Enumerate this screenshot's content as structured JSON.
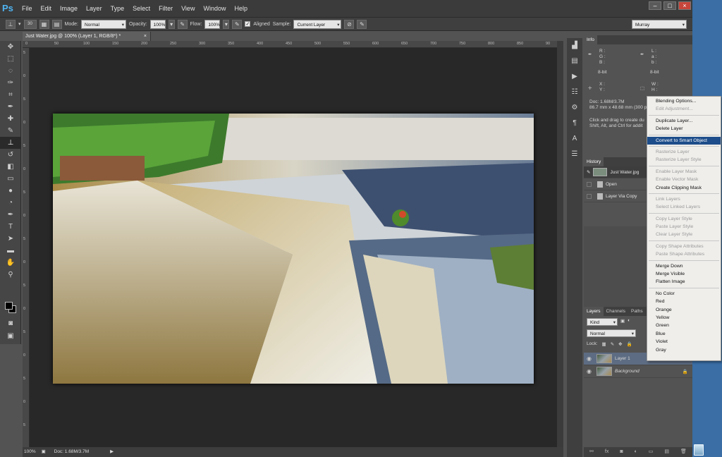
{
  "menubar": {
    "logo": "Ps",
    "items": [
      "File",
      "Edit",
      "Image",
      "Layer",
      "Type",
      "Select",
      "Filter",
      "View",
      "Window",
      "Help"
    ]
  },
  "options": {
    "brush_size": "30",
    "mode_label": "Mode:",
    "mode": "Normal",
    "opacity_label": "Opacity:",
    "opacity": "100%",
    "flow_label": "Flow:",
    "flow": "100%",
    "aligned_label": "Aligned",
    "sample_label": "Sample:",
    "sample": "Current Layer",
    "workspace": "Murray"
  },
  "document": {
    "tab_title": "Just Water.jpg @ 100% (Layer 1, RGB/8*) *",
    "zoom": "100%",
    "doc_size": "Doc: 1.68M/3.7M"
  },
  "ruler": {
    "h_ticks": [
      "0",
      "50",
      "100",
      "150",
      "200",
      "250",
      "300",
      "350",
      "400",
      "450",
      "500",
      "550",
      "600",
      "650",
      "700",
      "750",
      "800",
      "850",
      "90"
    ],
    "v_ticks": [
      "5",
      "0",
      "5",
      "0",
      "5",
      "0",
      "5",
      "0",
      "5",
      "0",
      "5",
      "0",
      "5",
      "0",
      "5",
      "0",
      "5"
    ]
  },
  "info_panel": {
    "tab": "Info",
    "rgb": "R :\nG :\nB :",
    "lab": "L :\na :\nb :",
    "bits_left": "8-bit",
    "bits_right": "8-bit",
    "xy": "X :\nY :",
    "wh": "W :\nH :",
    "doc": "Doc: 1.68M/3.7M",
    "dims": "86.7 mm x 48.68 mm (300 p",
    "hint": "Click and drag to create du\nShift, Alt, and Ctrl for addit"
  },
  "history_panel": {
    "tab": "History",
    "snapshot": "Just Water.jpg",
    "steps": [
      "Open",
      "Layer Via Copy"
    ]
  },
  "layers_panel": {
    "tabs": [
      "Layers",
      "Channels",
      "Paths"
    ],
    "kind": "Kind",
    "blend": "Normal",
    "lock_label": "Lock:",
    "layers": [
      {
        "name": "Layer 1"
      },
      {
        "name": "Background"
      }
    ]
  },
  "context_menu": {
    "groups": [
      [
        {
          "label": "Blending Options...",
          "disabled": false
        },
        {
          "label": "Edit Adjustment...",
          "disabled": true
        }
      ],
      [
        {
          "label": "Duplicate Layer...",
          "disabled": false
        },
        {
          "label": "Delete Layer",
          "disabled": false
        }
      ],
      [
        {
          "label": "Convert to Smart Object",
          "disabled": false,
          "highlight": true
        }
      ],
      [
        {
          "label": "Rasterize Layer",
          "disabled": true
        },
        {
          "label": "Rasterize Layer Style",
          "disabled": true
        }
      ],
      [
        {
          "label": "Enable Layer Mask",
          "disabled": true
        },
        {
          "label": "Enable Vector Mask",
          "disabled": true
        },
        {
          "label": "Create Clipping Mask",
          "disabled": false
        }
      ],
      [
        {
          "label": "Link Layers",
          "disabled": true
        },
        {
          "label": "Select Linked Layers",
          "disabled": true
        }
      ],
      [
        {
          "label": "Copy Layer Style",
          "disabled": true
        },
        {
          "label": "Paste Layer Style",
          "disabled": true
        },
        {
          "label": "Clear Layer Style",
          "disabled": true
        }
      ],
      [
        {
          "label": "Copy Shape Attributes",
          "disabled": true
        },
        {
          "label": "Paste Shape Attributes",
          "disabled": true
        }
      ],
      [
        {
          "label": "Merge Down",
          "disabled": false
        },
        {
          "label": "Merge Visible",
          "disabled": false
        },
        {
          "label": "Flatten Image",
          "disabled": false
        }
      ],
      [
        {
          "label": "No Color",
          "disabled": false
        },
        {
          "label": "Red",
          "disabled": false
        },
        {
          "label": "Orange",
          "disabled": false
        },
        {
          "label": "Yellow",
          "disabled": false
        },
        {
          "label": "Green",
          "disabled": false
        },
        {
          "label": "Blue",
          "disabled": false
        },
        {
          "label": "Violet",
          "disabled": false
        },
        {
          "label": "Gray",
          "disabled": false
        }
      ]
    ]
  },
  "colors": {
    "accent": "#1d4d8a",
    "ps_blue": "#4fb4f2",
    "desktop": "#3a6ea5"
  }
}
